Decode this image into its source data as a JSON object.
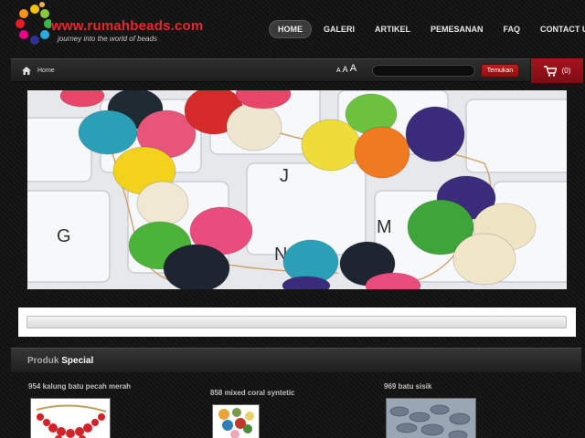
{
  "logo": {
    "url_text": "www.rumahbeads.com",
    "tagline": "journey into the world of beads"
  },
  "nav": {
    "items": [
      "HOME",
      "GALERI",
      "ARTIKEL",
      "PEMESANAN",
      "FAQ",
      "CONTACT US"
    ],
    "active": "HOME"
  },
  "breadcrumb": {
    "label": "Home"
  },
  "font_size_controls": [
    "A",
    "A",
    "A"
  ],
  "search": {
    "value": "",
    "button_label": "Temukan"
  },
  "cart": {
    "count_label": "(0)"
  },
  "banner": {
    "keys": [
      "G",
      "J",
      "N",
      "M"
    ]
  },
  "products": {
    "title_normal": "Produk",
    "title_highlight": "Special",
    "items": [
      {
        "name": "954 kalung batu pecah merah"
      },
      {
        "name": "858 mixed coral syntetic"
      },
      {
        "name": "969 batu sisik"
      }
    ]
  },
  "colors": {
    "brand_red": "#e8262b",
    "cart_red": "#a8141f",
    "button_red": "#c21d1d",
    "background": "#141414"
  }
}
